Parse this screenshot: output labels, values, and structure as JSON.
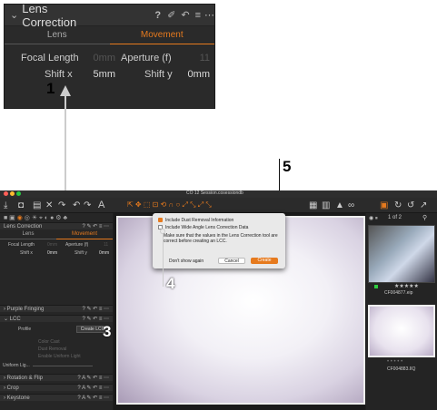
{
  "zoom": {
    "title": "Lens Correction",
    "icons": [
      "help-icon",
      "picker-icon",
      "reset-icon",
      "menu-icon",
      "more-icon"
    ],
    "tabs": [
      "Lens",
      "Movement"
    ],
    "fields": {
      "focal_label": "Focal Length",
      "focal_value": "0mm",
      "aperture_label": "Aperture (f)",
      "aperture_value": "11",
      "shiftx_label": "Shift x",
      "shiftx_value": "5mm",
      "shifty_label": "Shift y",
      "shifty_value": "0mm"
    }
  },
  "callouts": {
    "one": "1",
    "three": "3",
    "four": "4",
    "five": "5"
  },
  "window_title": "CO 12 Session.cosessiondb",
  "dialog": {
    "opt1": "Include Dust Removal Information",
    "opt2": "Include Wide Angle Lens Correction Data",
    "note": "Make sure that the values in the Lens Correction tool are correct before creating an LCC.",
    "dont_show": "Don't show again",
    "cancel": "Cancel",
    "create": "Create"
  },
  "left_panel": {
    "lens_title": "Lens Correction",
    "tabs": [
      "Lens",
      "Movement"
    ],
    "focal": "Focal Length",
    "focal_v": "0mm",
    "aperture": "Aperture (f)",
    "aperture_v": "11",
    "shiftx": "Shift x",
    "shiftx_v": "0mm",
    "shifty": "Shift y",
    "shifty_v": "0mm",
    "sections": [
      "Purple Fringing",
      "LCC",
      "Rotation & Flip",
      "Crop",
      "Keystone"
    ],
    "lcc": {
      "profile": "Profile",
      "create": "Create LCC",
      "color_cast": "Color Cast",
      "dust": "Dust Removal",
      "light": "Enable Uniform Light",
      "uniform": "Uniform Lig..."
    }
  },
  "browser": {
    "count": "1 of 2",
    "thumbs": [
      {
        "name": "CF004877.eip",
        "rating": "★★★★★"
      },
      {
        "name": "CF004883.IIQ",
        "rating": "• • • • •"
      }
    ]
  },
  "colors": {
    "accent": "#e67a1e"
  }
}
